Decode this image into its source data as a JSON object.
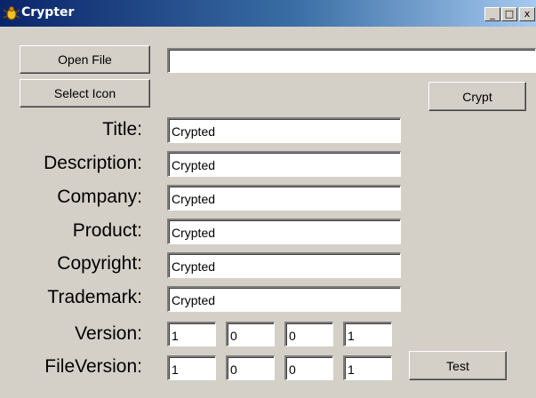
{
  "window": {
    "title": "Crypter",
    "icon": "bug-icon",
    "controls": {
      "minimize": "_",
      "maximize": "□",
      "close": "x"
    }
  },
  "buttons": {
    "open_file": "Open File",
    "select_icon": "Select Icon",
    "crypt": "Crypt",
    "test": "Test"
  },
  "file_path": {
    "value": ""
  },
  "fields": {
    "title": {
      "label": "Title:",
      "value": "Crypted"
    },
    "description": {
      "label": "Description:",
      "value": "Crypted"
    },
    "company": {
      "label": "Company:",
      "value": "Crypted"
    },
    "product": {
      "label": "Product:",
      "value": "Crypted"
    },
    "copyright": {
      "label": "Copyright:",
      "value": "Crypted"
    },
    "trademark": {
      "label": "Trademark:",
      "value": "Crypted"
    }
  },
  "version": {
    "label": "Version:",
    "parts": [
      "1",
      "0",
      "0",
      "1"
    ]
  },
  "file_version": {
    "label": "FileVersion:",
    "parts": [
      "1",
      "0",
      "0",
      "1"
    ]
  }
}
